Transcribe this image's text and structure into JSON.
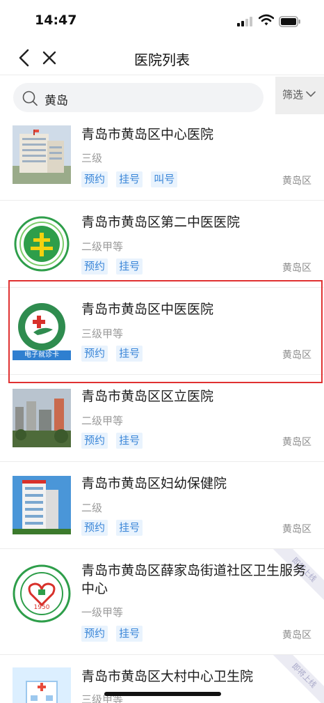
{
  "status_bar": {
    "time": "14:47"
  },
  "nav": {
    "title": "医院列表"
  },
  "search": {
    "value": "黄岛",
    "filter_label": "筛选"
  },
  "hospitals": [
    {
      "name": "青岛市黄岛区中心医院",
      "level": "三级",
      "tags": [
        "预约",
        "挂号",
        "叫号"
      ],
      "district": "黄岛区",
      "thumb": "building-photo"
    },
    {
      "name": "青岛市黄岛区第二中医医院",
      "level": "二级甲等",
      "tags": [
        "预约",
        "挂号"
      ],
      "district": "黄岛区",
      "thumb": "green-logo"
    },
    {
      "name": "青岛市黄岛区中医医院",
      "level": "三级甲等",
      "tags": [
        "预约",
        "挂号"
      ],
      "district": "黄岛区",
      "thumb": "tcm-logo",
      "thumb_caption": "电子就诊卡"
    },
    {
      "name": "青岛市黄岛区区立医院",
      "level": "二级甲等",
      "tags": [
        "预约",
        "挂号"
      ],
      "district": "黄岛区",
      "thumb": "city-photo"
    },
    {
      "name": "青岛市黄岛区妇幼保健院",
      "level": "二级",
      "tags": [
        "预约",
        "挂号"
      ],
      "district": "黄岛区",
      "thumb": "tower-photo"
    },
    {
      "name": "青岛市黄岛区薛家岛街道社区卫生服务中心",
      "level": "一级甲等",
      "tags": [
        "预约",
        "挂号"
      ],
      "district": "黄岛区",
      "thumb": "round-logo",
      "thumb_caption": "1950",
      "ribbon": "即将上线"
    },
    {
      "name": "青岛市黄岛区大村中心卫生院",
      "level": "三级甲等",
      "tags": [],
      "district": "",
      "thumb": "clinic-icon",
      "ribbon": "即将上线"
    }
  ],
  "colors": {
    "tag_text": "#3a86d8",
    "tag_bg": "#e9f3fd",
    "highlight": "#e03131"
  }
}
